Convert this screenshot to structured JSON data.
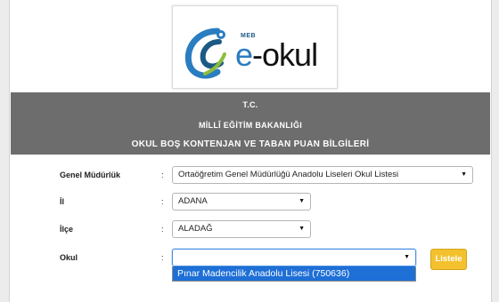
{
  "logo": {
    "brand_prefix": "MEB",
    "brand_name": "e-okul"
  },
  "header": {
    "line1": "T.C.",
    "line2": "MİLLÎ EĞİTİM BAKANLIĞI",
    "line3": "OKUL BOŞ KONTENJAN VE TABAN PUAN BİLGİLERİ"
  },
  "form": {
    "colon": ":",
    "genel_mudurluk": {
      "label": "Genel Müdürlük",
      "value": "Ortaöğretim Genel Müdürlüğü Anadolu Liseleri Okul Listesi"
    },
    "il": {
      "label": "İl",
      "value": "ADANA"
    },
    "ilce": {
      "label": "İlçe",
      "value": "ALADAĞ"
    },
    "okul": {
      "label": "Okul",
      "value": ""
    },
    "dropdown_arrow": "▼",
    "okul_options": [
      "Pınar Madencilik Anadolu Lisesi (750636)"
    ],
    "list_button": "Listele"
  },
  "colors": {
    "header_bg": "#6d6d6d",
    "button_bg": "#f3c12e",
    "option_highlight": "#1e6fd6",
    "brand_blue": "#2a7dc0",
    "brand_green": "#8dbd3a"
  }
}
